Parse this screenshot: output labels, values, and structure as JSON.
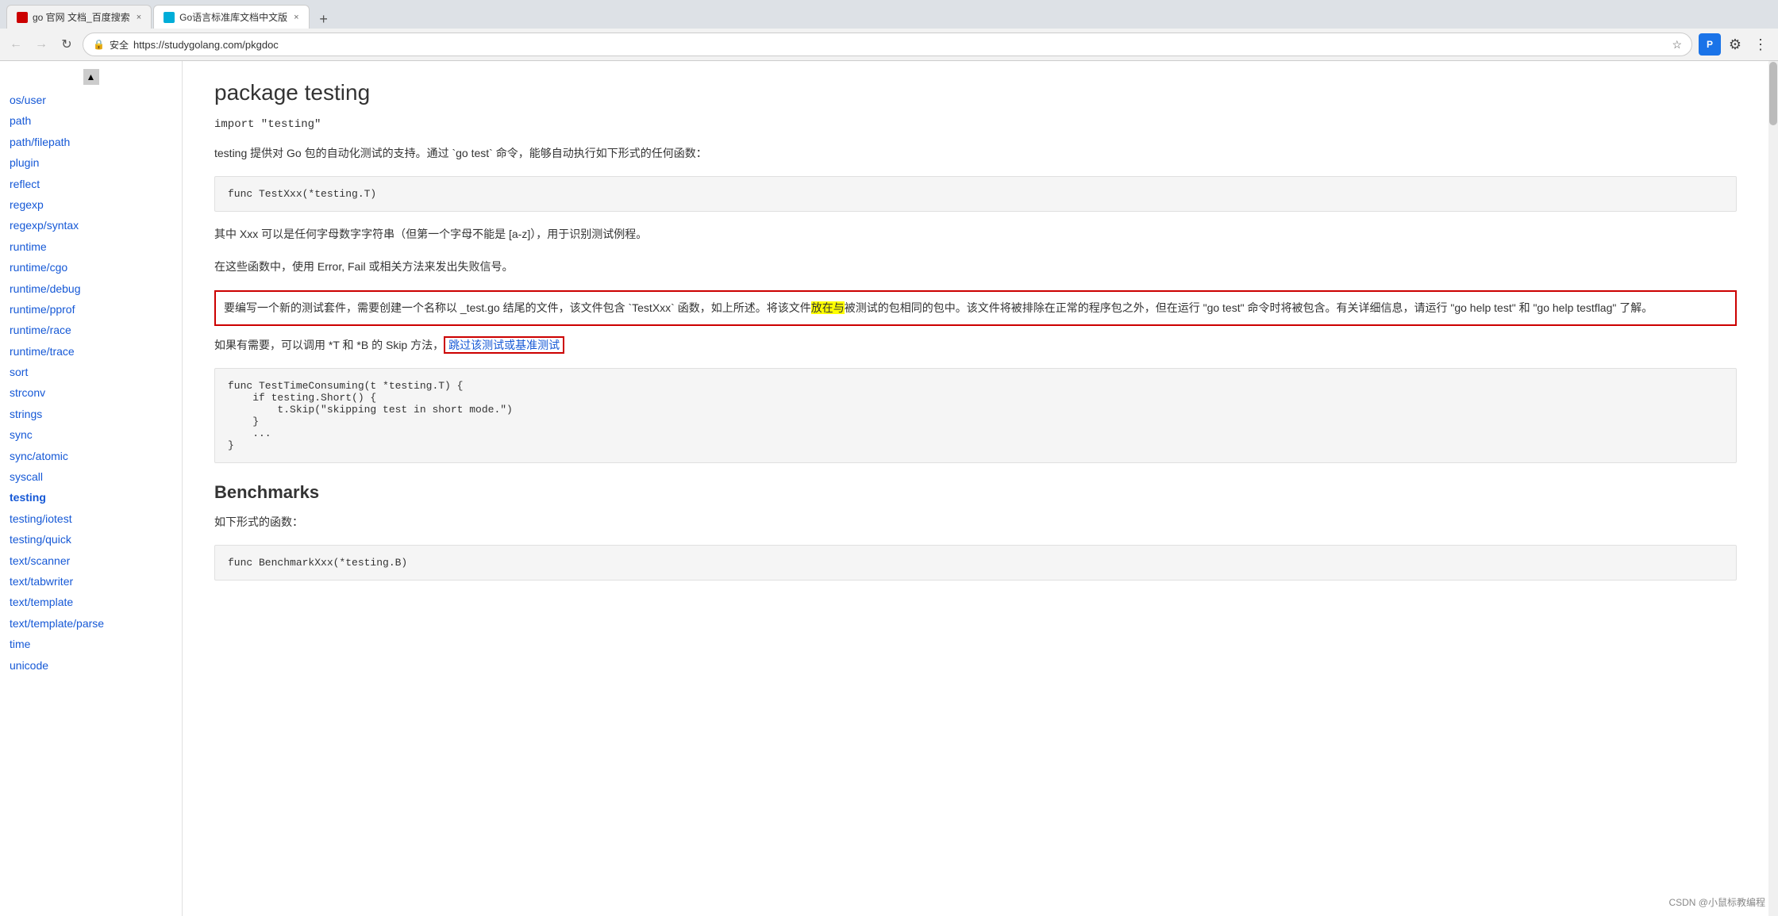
{
  "browser": {
    "tabs": [
      {
        "id": "tab1",
        "favicon": "baidu",
        "label": "go 官网 文档_百度搜索",
        "active": false,
        "close": "×"
      },
      {
        "id": "tab2",
        "favicon": "go",
        "label": "Go语言标准库文档中文版",
        "active": true,
        "close": "×"
      }
    ],
    "tab_new_label": "+",
    "nav": {
      "back": "←",
      "forward": "→",
      "reload": "↻"
    },
    "url": {
      "lock_icon": "🔒",
      "security_label": "安全",
      "address": "https://studygolang.com/pkgdoc"
    },
    "star_icon": "☆",
    "actions": {
      "bookmark": "☆",
      "menu": "⋮",
      "profile_label": "P"
    }
  },
  "sidebar": {
    "scroll_up": "▲",
    "items": [
      {
        "label": "os/user",
        "href": "#",
        "active": false
      },
      {
        "label": "path",
        "href": "#",
        "active": false
      },
      {
        "label": "path/filepath",
        "href": "#",
        "active": false
      },
      {
        "label": "plugin",
        "href": "#",
        "active": false
      },
      {
        "label": "reflect",
        "href": "#",
        "active": false
      },
      {
        "label": "regexp",
        "href": "#",
        "active": false
      },
      {
        "label": "regexp/syntax",
        "href": "#",
        "active": false
      },
      {
        "label": "runtime",
        "href": "#",
        "active": false
      },
      {
        "label": "runtime/cgo",
        "href": "#",
        "active": false
      },
      {
        "label": "runtime/debug",
        "href": "#",
        "active": false
      },
      {
        "label": "runtime/pprof",
        "href": "#",
        "active": false
      },
      {
        "label": "runtime/race",
        "href": "#",
        "active": false
      },
      {
        "label": "runtime/trace",
        "href": "#",
        "active": false
      },
      {
        "label": "sort",
        "href": "#",
        "active": false
      },
      {
        "label": "strconv",
        "href": "#",
        "active": false
      },
      {
        "label": "strings",
        "href": "#",
        "active": false
      },
      {
        "label": "sync",
        "href": "#",
        "active": false
      },
      {
        "label": "sync/atomic",
        "href": "#",
        "active": false
      },
      {
        "label": "syscall",
        "href": "#",
        "active": false
      },
      {
        "label": "testing",
        "href": "#",
        "active": true
      },
      {
        "label": "testing/iotest",
        "href": "#",
        "active": false
      },
      {
        "label": "testing/quick",
        "href": "#",
        "active": false
      },
      {
        "label": "text/scanner",
        "href": "#",
        "active": false
      },
      {
        "label": "text/tabwriter",
        "href": "#",
        "active": false
      },
      {
        "label": "text/template",
        "href": "#",
        "active": false
      },
      {
        "label": "text/template/parse",
        "href": "#",
        "active": false
      },
      {
        "label": "time",
        "href": "#",
        "active": false
      },
      {
        "label": "unicode",
        "href": "#",
        "active": false
      }
    ]
  },
  "content": {
    "package_title": "package testing",
    "import_line": "import \"testing\"",
    "description1": "testing 提供对 Go 包的自动化测试的支持。通过 `go test` 命令，能够自动执行如下形式的任何函数：",
    "code1": "func TestXxx(*testing.T)",
    "description2": "其中 Xxx 可以是任何字母数字字符串（但第一个字母不能是 [a-z]），用于识别测试例程。",
    "description3": "在这些函数中，使用 Error, Fail 或相关方法来发出失败信号。",
    "highlighted_block": {
      "part1": "要编写一个新的测试套件，需要创建一个名称以 _test.go 结尾的文件，该文件包含 `TestXxx` 函数，如上所述。将该文件",
      "highlight1": "放在与",
      "part2": "被测试的包相同的包中。该文件将被排除在正常的程序包之外，但在运行 \"go test\" 命令时将被包含。有关详细信息，请运行 \"go help test\" 和 \"go help testflag\" 了解。"
    },
    "skip_description": "如果有需要，可以调用 *T 和 *B 的 Skip 方法，",
    "skip_link": "跳过该测试或基准测试",
    "code2": "func TestTimeConsuming(t *testing.T) {\n    if testing.Short() {\n        t.Skip(\"skipping test in short mode.\")\n    }\n    ...\n}",
    "benchmarks_title": "Benchmarks",
    "benchmarks_desc": "如下形式的函数：",
    "code3": "func BenchmarkXxx(*testing.B)"
  },
  "watermark": "CSDN @小鼠标教编程"
}
